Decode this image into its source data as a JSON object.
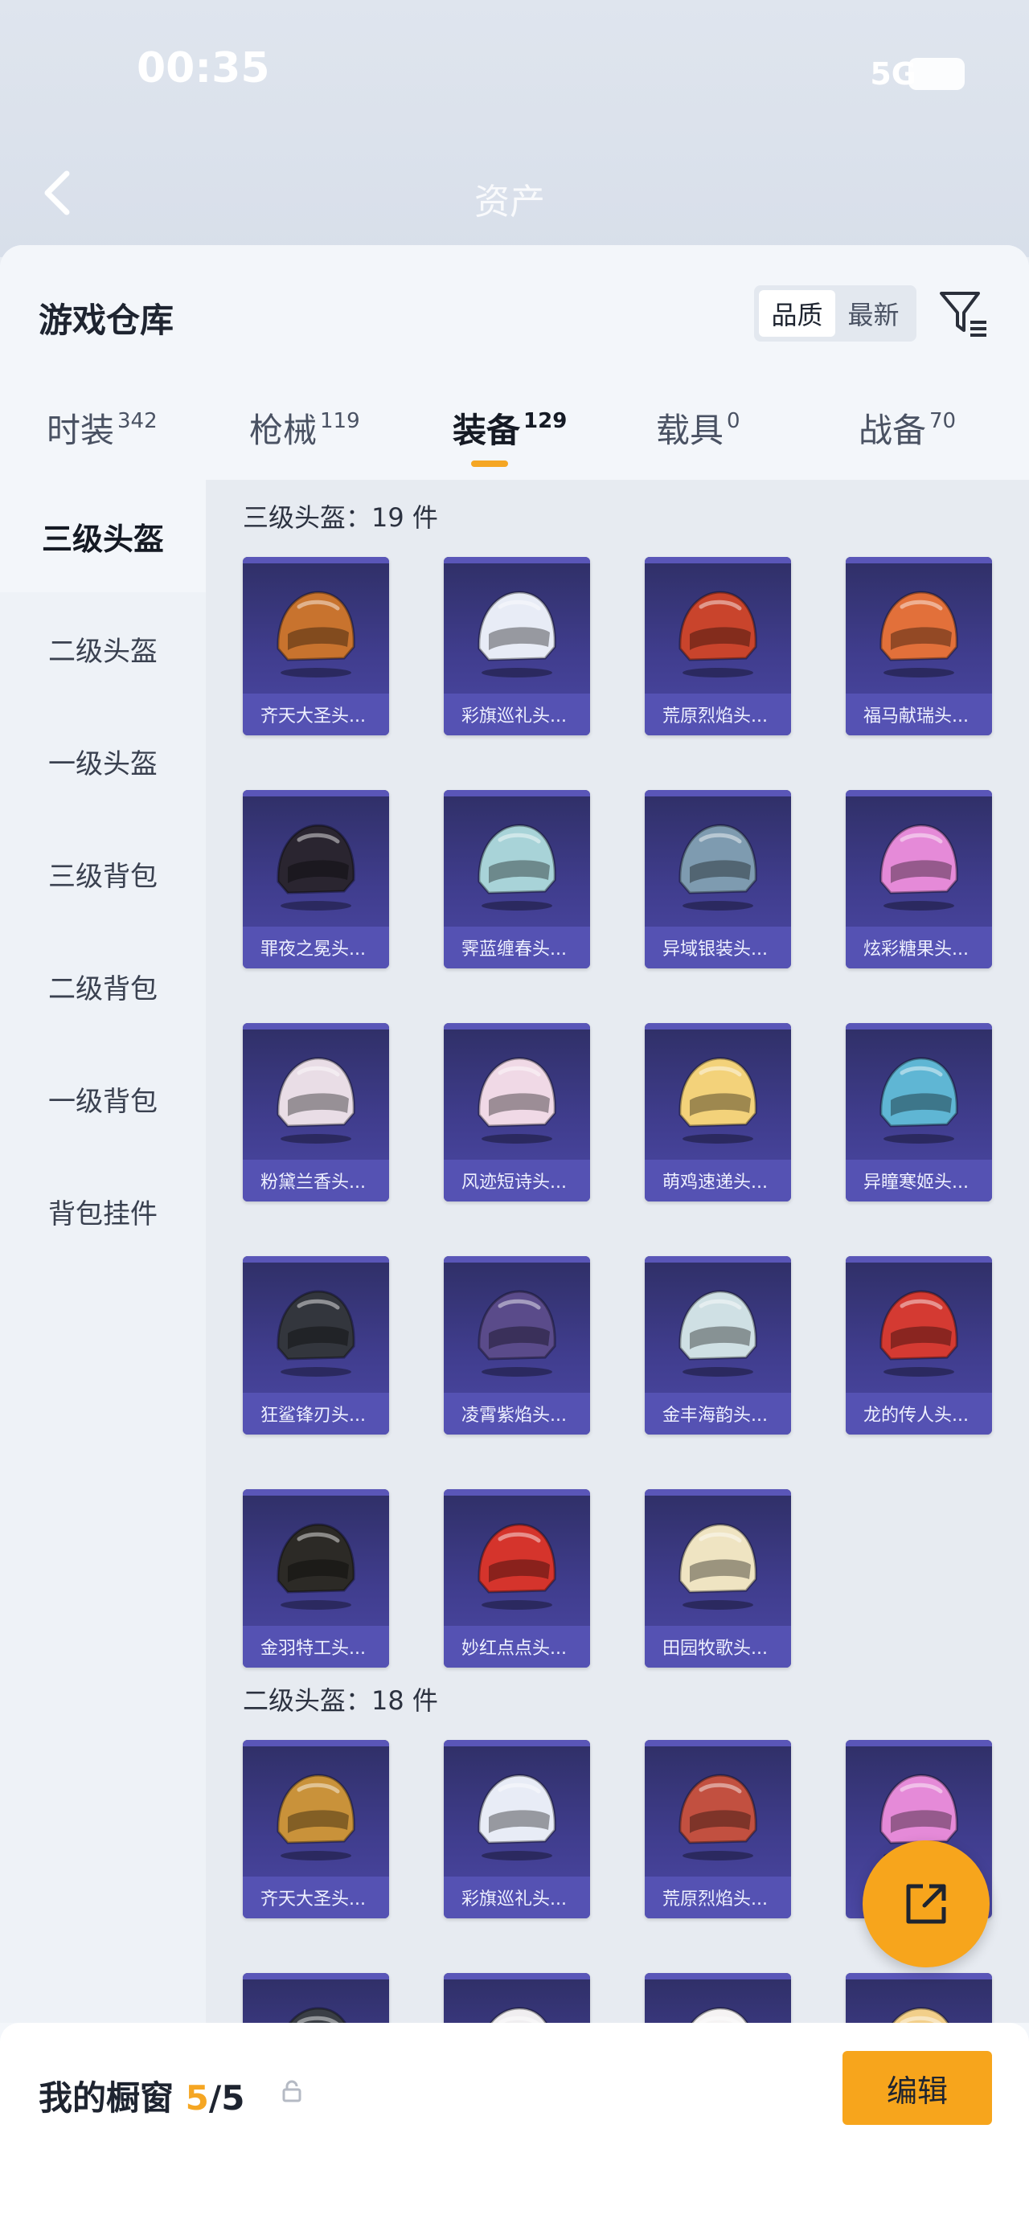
{
  "status": {
    "time": "00:35",
    "network": "5G"
  },
  "header": {
    "title": "资产"
  },
  "sheet": {
    "title": "游戏仓库",
    "sort": [
      "品质",
      "最新"
    ],
    "tabs": [
      {
        "label": "时装",
        "count": "342"
      },
      {
        "label": "枪械",
        "count": "119"
      },
      {
        "label": "装备",
        "count": "129"
      },
      {
        "label": "载具",
        "count": "0"
      },
      {
        "label": "战备",
        "count": "70"
      }
    ]
  },
  "categories": [
    "三级头盔",
    "二级头盔",
    "一级头盔",
    "三级背包",
    "二级背包",
    "一级背包",
    "背包挂件"
  ],
  "sections": [
    {
      "title": "三级头盔：19 件",
      "items": [
        {
          "name": "齐天大圣头...",
          "color": "#c8732e"
        },
        {
          "name": "彩旗巡礼头...",
          "color": "#e8ecf6"
        },
        {
          "name": "荒原烈焰头...",
          "color": "#c9442c"
        },
        {
          "name": "福马献瑞头...",
          "color": "#e2703a"
        },
        {
          "name": "罪夜之冕头...",
          "color": "#2a2530"
        },
        {
          "name": "霁蓝缠春头...",
          "color": "#a8d3d8"
        },
        {
          "name": "异域银装头...",
          "color": "#7e9bb0"
        },
        {
          "name": "炫彩糖果头...",
          "color": "#e58ad8"
        },
        {
          "name": "粉黛兰香头...",
          "color": "#e9dde6"
        },
        {
          "name": "风迹短诗头...",
          "color": "#f0d9e6"
        },
        {
          "name": "萌鸡速递头...",
          "color": "#f3d27a"
        },
        {
          "name": "异瞳寒姬头...",
          "color": "#5fb6d4"
        },
        {
          "name": "狂鲨锋刃头...",
          "color": "#33363d"
        },
        {
          "name": "凌霄紫焰头...",
          "color": "#5a4b8a"
        },
        {
          "name": "金丰海韵头...",
          "color": "#cfe0e4"
        },
        {
          "name": "龙的传人头...",
          "color": "#d43a32"
        },
        {
          "name": "金羽特工头...",
          "color": "#2c2a26"
        },
        {
          "name": "妙红点点头...",
          "color": "#d5342c"
        },
        {
          "name": "田园牧歌头...",
          "color": "#efe4c2"
        }
      ]
    },
    {
      "title": "二级头盔：18 件",
      "items": [
        {
          "name": "齐天大圣头...",
          "color": "#c9923a"
        },
        {
          "name": "彩旗巡礼头...",
          "color": "#e8ecf6"
        },
        {
          "name": "荒原烈焰头...",
          "color": "#c25040"
        },
        {
          "name": "",
          "color": "#e58ad8"
        },
        {
          "name": "",
          "color": "#3a3e45"
        },
        {
          "name": "",
          "color": "#f0eef0"
        },
        {
          "name": "",
          "color": "#f5f3f3"
        },
        {
          "name": "",
          "color": "#f2cf8a"
        }
      ]
    }
  ],
  "bottom": {
    "title": "我的橱窗",
    "used": "5",
    "total": "/5",
    "edit": "编辑"
  },
  "colors": {
    "accent": "#f7a51c",
    "card": "#403d8e"
  }
}
